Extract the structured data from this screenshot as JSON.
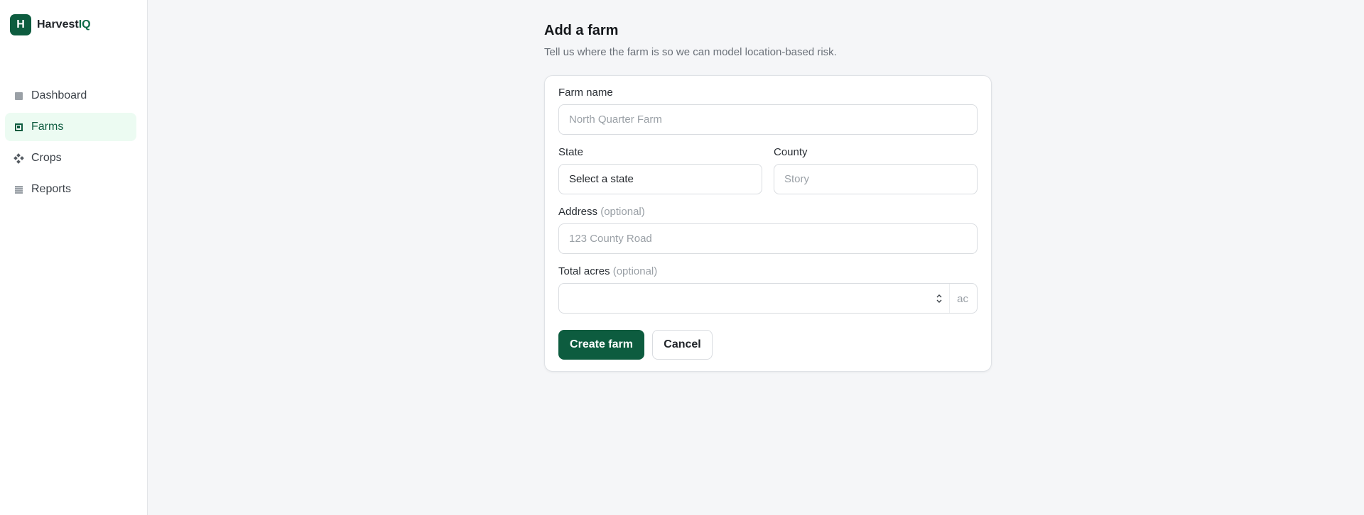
{
  "brand": {
    "logo_letter": "H",
    "name_main": "Harvest",
    "name_accent": "IQ",
    "accent_color": "#0d5c3f"
  },
  "sidebar": {
    "items": [
      {
        "label": "Dashboard",
        "icon": "dashboard-icon",
        "active": false
      },
      {
        "label": "Farms",
        "icon": "farms-icon",
        "active": true
      },
      {
        "label": "Crops",
        "icon": "crops-icon",
        "active": false
      },
      {
        "label": "Reports",
        "icon": "reports-icon",
        "active": false
      }
    ]
  },
  "page": {
    "title": "Add a farm",
    "subtitle": "Tell us where the farm is so we can model location-based risk."
  },
  "form": {
    "farm_name": {
      "label": "Farm name",
      "placeholder": "North Quarter Farm"
    },
    "state": {
      "label": "State",
      "value": "Select a state"
    },
    "county": {
      "label": "County",
      "placeholder": "Story"
    },
    "address": {
      "label": "Address",
      "optional": "(optional)",
      "placeholder": "123 County Road"
    },
    "total_acres": {
      "label": "Total acres",
      "optional": "(optional)",
      "value": "",
      "unit": "ac"
    },
    "submit_label": "Create farm",
    "cancel_label": "Cancel"
  }
}
